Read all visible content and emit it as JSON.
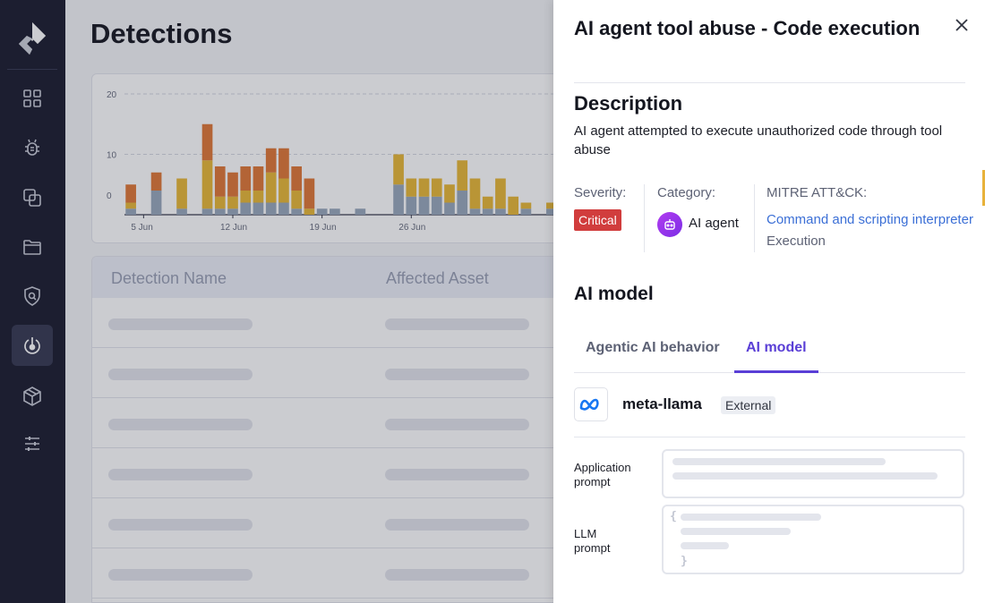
{
  "page": {
    "title": "Detections"
  },
  "sidebar": {
    "items": [
      {
        "icon": "dashboard-grid-icon"
      },
      {
        "icon": "bug-icon"
      },
      {
        "icon": "copy-icon"
      },
      {
        "icon": "folder-icon"
      },
      {
        "icon": "shield-search-icon"
      },
      {
        "icon": "detection-radar-icon",
        "active": true
      },
      {
        "icon": "cube-icon"
      },
      {
        "icon": "sliders-icon"
      }
    ]
  },
  "chart_data": {
    "type": "bar",
    "stacked": true,
    "ylim": [
      0,
      20
    ],
    "yticks": [
      "20",
      "10",
      "0"
    ],
    "xticks": [
      "5 Jun",
      "12 Jun",
      "19 Jun",
      "26 Jun"
    ],
    "colors": {
      "gray": "#9aa9bd",
      "yellow": "#e8b93a",
      "orange": "#e07a3a",
      "red": "#c93b47"
    },
    "series": [
      {
        "name": "",
        "color_key": "gray",
        "values": [
          1,
          0,
          4,
          0,
          1,
          0,
          1,
          1,
          1,
          2,
          2,
          2,
          2,
          1,
          0,
          1,
          1,
          0,
          1,
          0,
          0,
          5,
          3,
          3,
          3,
          2,
          4,
          1,
          1,
          1,
          0,
          1,
          0,
          1
        ]
      },
      {
        "name": "",
        "color_key": "yellow",
        "values": [
          1,
          0,
          0,
          0,
          5,
          0,
          8,
          2,
          2,
          2,
          2,
          5,
          4,
          3,
          1,
          0,
          0,
          0,
          0,
          0,
          0,
          5,
          3,
          3,
          3,
          3,
          5,
          5,
          2,
          5,
          3,
          1,
          0,
          1
        ]
      },
      {
        "name": "",
        "color_key": "orange",
        "values": [
          3,
          0,
          3,
          0,
          0,
          0,
          6,
          5,
          4,
          4,
          4,
          4,
          5,
          4,
          5,
          0,
          0,
          0,
          0,
          0,
          0,
          0,
          0,
          0,
          0,
          0,
          0,
          0,
          0,
          0,
          0,
          0,
          0,
          0
        ]
      },
      {
        "name": "",
        "color_key": "red",
        "values": [
          0,
          0,
          0,
          0,
          0,
          0,
          0,
          0,
          0,
          0,
          0,
          0,
          0,
          0,
          0,
          0,
          0,
          0,
          0,
          0,
          0,
          0,
          0,
          0,
          0,
          0,
          0,
          0,
          0,
          0,
          0,
          0,
          0,
          0
        ]
      }
    ]
  },
  "table": {
    "headers": [
      "Detection Name",
      "Affected Asset"
    ],
    "row_count": 6
  },
  "drawer": {
    "title": "AI agent tool abuse - Code execution",
    "description_heading": "Description",
    "description": "AI agent attempted to execute unauthorized code through tool abuse",
    "severity_label": "Severity:",
    "severity_value": "Critical",
    "category_label": "Category:",
    "category_value": "AI agent",
    "mitre_label": "MITRE ATT&CK:",
    "mitre_technique": "Command and scripting interpreter",
    "mitre_tactic": "Execution",
    "ai_model_heading": "AI model",
    "tabs": [
      {
        "label": "Agentic AI behavior",
        "active": false
      },
      {
        "label": "AI model",
        "active": true
      }
    ],
    "model_name": "meta-llama",
    "model_tag": "External",
    "application_prompt_label": "Application prompt",
    "llm_prompt_label": "LLM prompt",
    "open_brace": "{",
    "close_brace": "}"
  },
  "colors": {
    "sidebar_bg": "#1f2133",
    "accent_purple": "#5a3fd6",
    "critical_red": "#d13d3d",
    "link_blue": "#3b6fd6"
  }
}
